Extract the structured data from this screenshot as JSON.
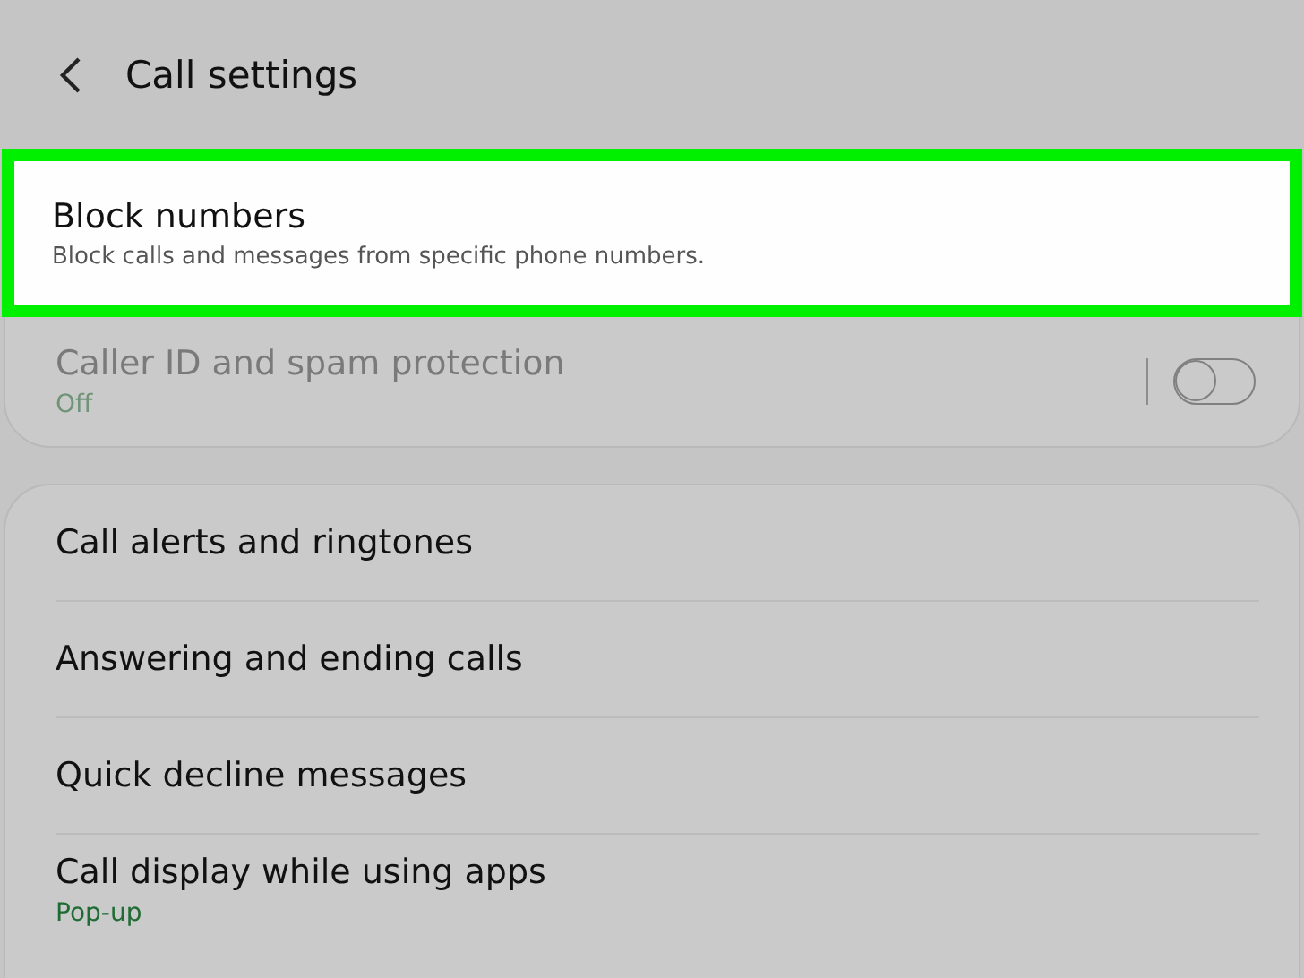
{
  "header": {
    "title": "Call settings"
  },
  "sections": [
    {
      "items": [
        {
          "kind": "link",
          "title": "Block numbers",
          "subtitle": "Block calls and messages from specific phone numbers.",
          "highlighted": true,
          "disabled": false
        },
        {
          "kind": "toggle",
          "title": "Caller ID and spam protection",
          "subtitle": "Off",
          "on": false,
          "disabled": true,
          "highlighted": false
        }
      ]
    },
    {
      "items": [
        {
          "kind": "link",
          "title": "Call alerts and ringtones",
          "highlighted": false,
          "disabled": false
        },
        {
          "kind": "link",
          "title": "Answering and ending calls",
          "highlighted": false,
          "disabled": false
        },
        {
          "kind": "link",
          "title": "Quick decline messages",
          "highlighted": false,
          "disabled": false
        },
        {
          "kind": "link",
          "title": "Call display while using apps",
          "subtitle": "Pop-up",
          "highlighted": false,
          "disabled": false
        }
      ]
    }
  ]
}
